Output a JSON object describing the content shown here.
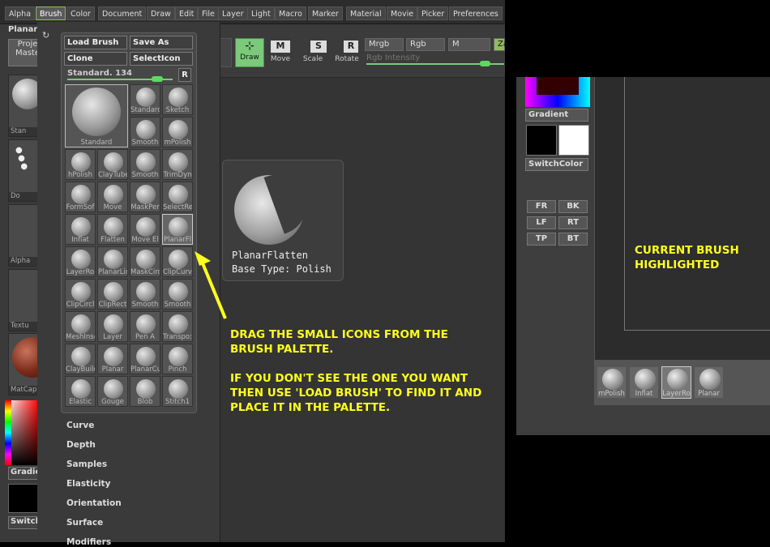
{
  "menu": [
    "Alpha",
    "Brush",
    "Color",
    "Document",
    "Draw",
    "Edit",
    "File",
    "Layer",
    "Light",
    "Macro",
    "Marker",
    "Material",
    "Movie",
    "Picker",
    "Preferences"
  ],
  "header": {
    "panel_title": "Planar"
  },
  "left_tray": {
    "project_btn_l1": "Proje",
    "project_btn_l2": "Maste",
    "thumb_labels": [
      "Stan",
      "Do",
      "Alpha",
      "Textu",
      "MatCap"
    ],
    "gradient_label": "Gradie",
    "switch_label": "Switch"
  },
  "toolbar": {
    "draw": "Draw",
    "move": "Move",
    "scale": "Scale",
    "rotate": "Rotate",
    "mrgb": "Mrgb",
    "rgb": "Rgb",
    "m": "M",
    "zadd": "Za",
    "rgb_intensity": "Rgb Intensity",
    "m_key": "M",
    "s_key": "S",
    "r_key": "R"
  },
  "palette": {
    "load_brush": "Load Brush",
    "save_as": "Save As",
    "clone": "Clone",
    "select_icon": "SelectIcon",
    "current": "Standard. 134",
    "r_btn": "R",
    "big_label": "Standard",
    "cells": [
      "Standard",
      "Sketch",
      "Smooth",
      "mPolish",
      "hPolish",
      "ClayTube",
      "Smooth",
      "TrimDyn",
      "FormSof",
      "Move",
      "MaskPer",
      "SelectRe",
      "Inflat",
      "Flatten",
      "Move El",
      "PlanarFl",
      "LayerRo",
      "PlanarLir",
      "MaskCirc",
      "ClipCurv",
      "ClipCircl",
      "ClipRect",
      "Smooth",
      "Smooth",
      "MeshInse",
      "Layer",
      "Pen A",
      "Transpo:",
      "ClayBuild",
      "Planar",
      "PlanarCu",
      "Pinch",
      "Elastic",
      "Gouge",
      "Blob",
      "Stitch1"
    ],
    "submenus": [
      "Curve",
      "Depth",
      "Samples",
      "Elasticity",
      "Orientation",
      "Surface",
      "Modifiers"
    ]
  },
  "tooltip": {
    "name": "PlanarFlatten",
    "type": "Base Type: Polish"
  },
  "annotations": {
    "drag_l1": "DRAG THE SMALL ICONS FROM THE",
    "drag_l2": "BRUSH PALETTE.",
    "load_l1": "IF YOU DON'T SEE THE ONE YOU WANT",
    "load_l2": "THEN USE 'LOAD BRUSH' TO FIND IT AND",
    "load_l3": "PLACE IT IN THE PALETTE.",
    "current_l1": "CURRENT BRUSH",
    "current_l2": "HIGHLIGHTED"
  },
  "right_panel": {
    "gradient": "Gradient",
    "switch_color": "SwitchColor",
    "views": [
      "FR",
      "BK",
      "LF",
      "RT",
      "TP",
      "BT"
    ],
    "tray": [
      "mPolish",
      "Inflat",
      "LayerRo",
      "Planar"
    ]
  },
  "colors": {
    "annotation": "#ffff1f",
    "accent_green": "#7bc97b"
  }
}
